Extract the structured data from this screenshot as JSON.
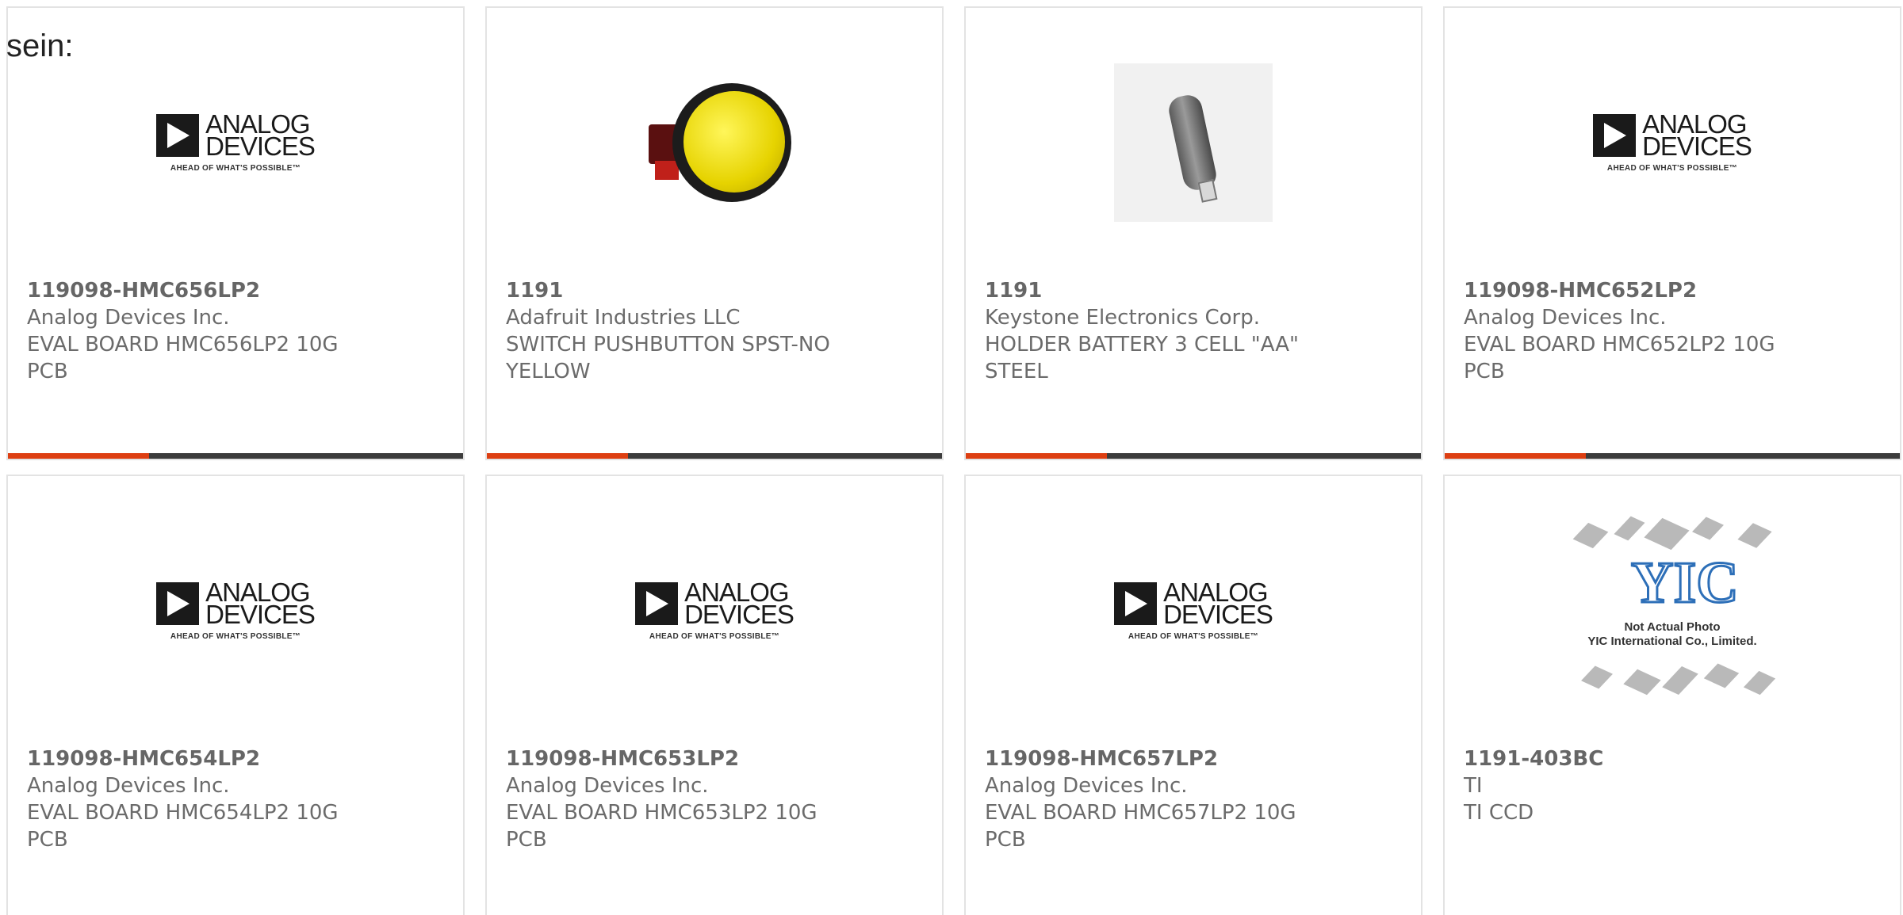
{
  "intro": "sein:",
  "colors": {
    "accent": "#dd3f12",
    "bar_track": "#3c3c3c",
    "card_border": "#e3e3e3",
    "text": "#6b6b6b"
  },
  "products": [
    {
      "part_number": "119098-HMC656LP2",
      "manufacturer": "Analog Devices Inc.",
      "desc1": "EVAL BOARD HMC656LP2 10G",
      "desc2": "PCB",
      "image": "analog-devices-logo",
      "progress": 0.31
    },
    {
      "part_number": "1191",
      "manufacturer": "Adafruit Industries LLC",
      "desc1": "SWITCH PUSHBUTTON SPST-NO",
      "desc2": "YELLOW",
      "image": "yellow-pushbutton-photo",
      "progress": 0.31
    },
    {
      "part_number": "1191",
      "manufacturer": "Keystone Electronics Corp.",
      "desc1": "HOLDER BATTERY 3 CELL \"AA\"",
      "desc2": "STEEL",
      "image": "battery-holder-photo",
      "progress": 0.31
    },
    {
      "part_number": "119098-HMC652LP2",
      "manufacturer": "Analog Devices Inc.",
      "desc1": "EVAL BOARD HMC652LP2 10G",
      "desc2": "PCB",
      "image": "analog-devices-logo",
      "progress": 0.31
    },
    {
      "part_number": "119098-HMC654LP2",
      "manufacturer": "Analog Devices Inc.",
      "desc1": "EVAL BOARD HMC654LP2 10G",
      "desc2": "PCB",
      "image": "analog-devices-logo"
    },
    {
      "part_number": "119098-HMC653LP2",
      "manufacturer": "Analog Devices Inc.",
      "desc1": "EVAL BOARD HMC653LP2 10G",
      "desc2": "PCB",
      "image": "analog-devices-logo"
    },
    {
      "part_number": "119098-HMC657LP2",
      "manufacturer": "Analog Devices Inc.",
      "desc1": "EVAL BOARD HMC657LP2 10G",
      "desc2": "PCB",
      "image": "analog-devices-logo"
    },
    {
      "part_number": "1191-403BC",
      "manufacturer": "TI",
      "desc1": "TI CCD",
      "desc2": "",
      "image": "not-actual-photo-placeholder"
    }
  ],
  "logos": {
    "analog_devices": {
      "line1": "ANALOG",
      "line2": "DEVICES",
      "tagline": "AHEAD OF WHAT'S POSSIBLE™"
    },
    "yic": {
      "mark": "YIC",
      "caption1": "Not Actual Photo",
      "caption2": "YIC International Co., Limited."
    }
  }
}
